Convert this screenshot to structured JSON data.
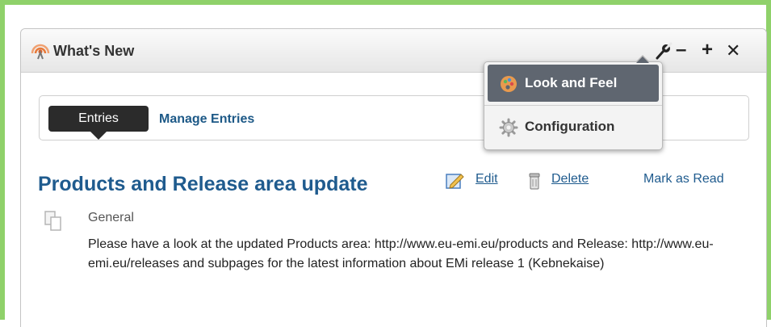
{
  "portlet": {
    "title": "What's New",
    "controls": {
      "minimize": "–",
      "maximize": "+",
      "close": "✕"
    }
  },
  "nav": {
    "tabs": [
      {
        "label": "Entries",
        "active": true
      },
      {
        "label": "Manage Entries",
        "active": false
      }
    ]
  },
  "entry": {
    "title": "Products and Release area update",
    "actions": {
      "edit": "Edit",
      "delete": "Delete",
      "mark_read": "Mark as Read"
    },
    "category": "General",
    "body": "Please have a look at the updated Products area: http://www.eu-emi.eu/products and Release: http://www.eu-emi.eu/releases and subpages for the latest information about EMi release 1 (Kebnekaise)"
  },
  "menu": {
    "items": [
      {
        "label": "Look and Feel",
        "icon": "palette-icon",
        "active": true
      },
      {
        "label": "Configuration",
        "icon": "gear-icon",
        "active": false
      }
    ]
  },
  "colors": {
    "outer_border": "#8fd16a",
    "link": "#1f5b8e",
    "tab_active_bg": "#2b2b2b",
    "menu_active_bg": "#5f6670"
  }
}
